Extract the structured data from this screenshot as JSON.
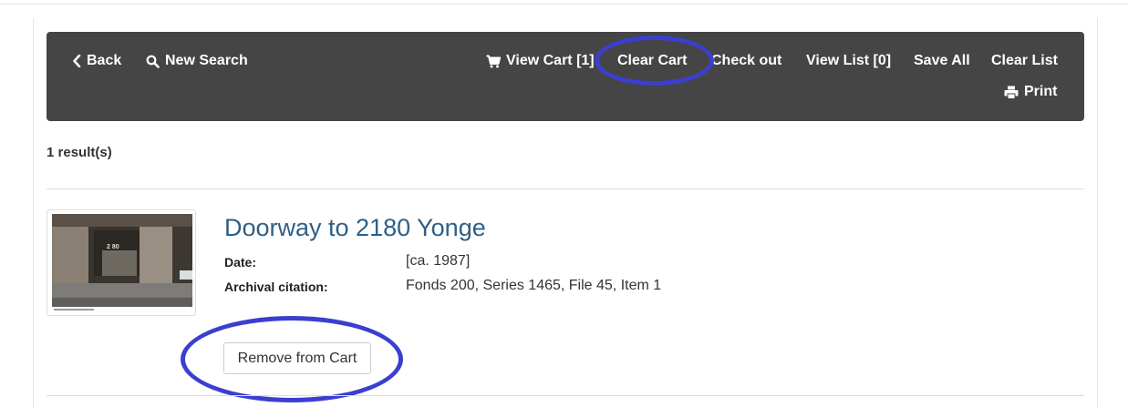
{
  "toolbar": {
    "back_label": "Back",
    "new_search_label": "New Search",
    "view_cart_label": "View Cart [1]",
    "clear_cart_label": "Clear Cart",
    "check_out_label": "Check out",
    "view_list_label": "View List [0]",
    "save_all_label": "Save All",
    "clear_list_label": "Clear List",
    "print_label": "Print"
  },
  "results": {
    "count_label": "1 result(s)"
  },
  "item": {
    "title": "Doorway to 2180 Yonge",
    "date_label": "Date:",
    "date_value": "[ca. 1987]",
    "citation_label": "Archival citation:",
    "citation_value": "Fonds 200, Series 1465, File 45, Item 1",
    "remove_label": "Remove from Cart",
    "thumbnail_number": "2 80"
  },
  "colors": {
    "toolbar_bg": "#454545",
    "title_link": "#2f5f85",
    "highlight_circle": "#3b3fcf"
  },
  "icons": {
    "back": "chevron-left-icon",
    "new_search": "search-icon",
    "view_cart": "cart-icon",
    "print": "printer-icon"
  }
}
